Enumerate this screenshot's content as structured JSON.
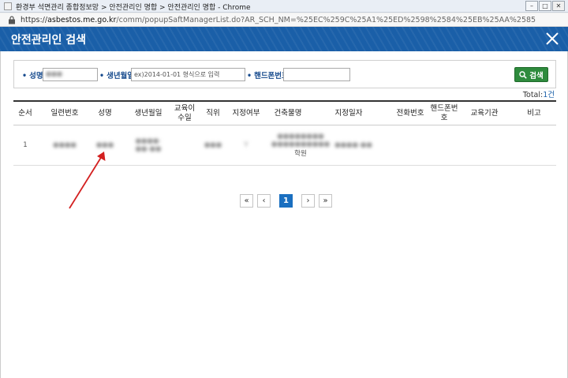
{
  "window": {
    "title": "환경부 석면관리 종합정보망 > 안전관리인 명합 > 안전관리인 명합 - Chrome",
    "url_prefix": "https://",
    "url_host": "asbestos.me.go.kr",
    "url_path": "/comm/popupSaftManagerList.do?AR_SCH_NM=%25EC%259C%25A1%25ED%2598%2584%25EB%25AA%2585"
  },
  "popup": {
    "heading": "안전관리인 검색"
  },
  "search": {
    "name_label": "성명",
    "name_value": "●●●",
    "birth_label": "생년월일",
    "birth_placeholder": "ex)2014-01-01 형식으로 입력",
    "phone_label": "핸드폰번호",
    "phone_value": "",
    "button_label": "검색"
  },
  "total": {
    "label": "Total:",
    "count": "1건"
  },
  "table": {
    "columns": [
      "순서",
      "일련번호",
      "성명",
      "생년월일",
      "교육이수일",
      "직위",
      "지정여부",
      "건축물명",
      "지정일자",
      "전화번호",
      "핸드폰번호",
      "교육기관",
      "비고"
    ],
    "rows": [
      {
        "order": "1",
        "serial": "●●●●",
        "name": "●●●",
        "birth": "●●●●-●●-●●",
        "edu_date": "",
        "position": "●●●",
        "designated": "Y",
        "building_line1": "●●●●●●●●",
        "building_line2": "●●●●●●●●●●",
        "building_line3": "학원",
        "designated_date": "●●●●-●●",
        "phone": "",
        "mobile": "",
        "edu_org": "",
        "note": ""
      }
    ]
  },
  "pagination": {
    "first": "«",
    "prev": "‹",
    "current": "1",
    "next": "›",
    "last": "»"
  },
  "colors": {
    "header_blue": "#1a5fa8",
    "search_green": "#2e8b3d",
    "label_blue": "#1a4d8f",
    "annotation_red": "#d32020"
  }
}
